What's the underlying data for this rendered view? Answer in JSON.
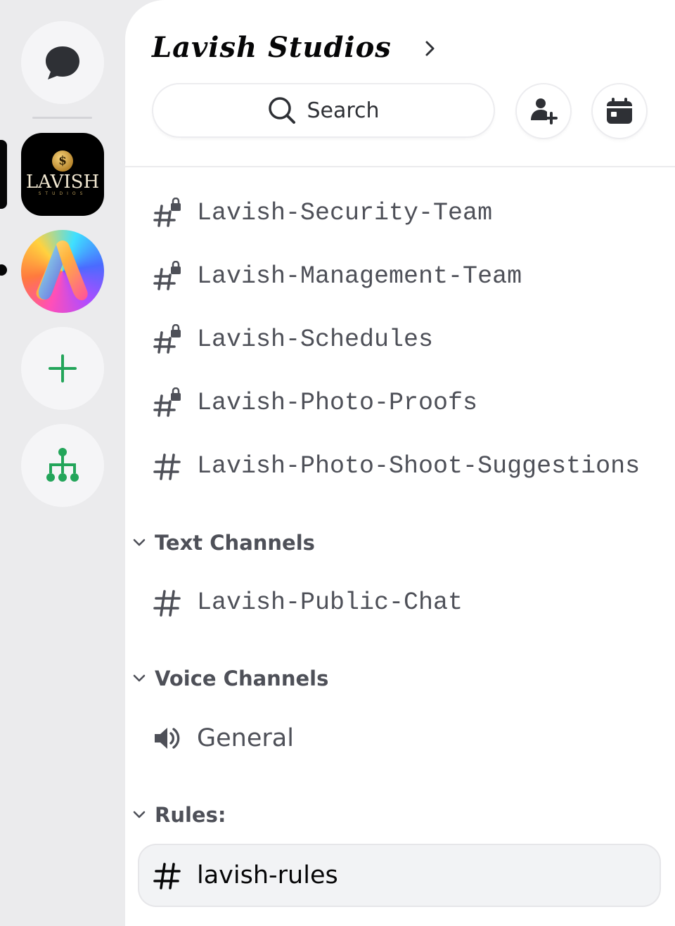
{
  "server_rail": {
    "direct_messages": {
      "icon": "chat-bubble-icon"
    },
    "servers": [
      {
        "name": "LAVISH",
        "sub": "STUDIOS",
        "initial": "$"
      },
      {
        "icon": "gradient-a-logo-icon"
      }
    ],
    "add_server": {
      "icon": "plus-icon",
      "color": "#23a55a"
    },
    "discover": {
      "icon": "hierarchy-icon",
      "color": "#23a55a"
    }
  },
  "header": {
    "server_name": "Lavish Studios",
    "search_label": "Search",
    "invite_icon": "add-person-icon",
    "events_icon": "calendar-icon"
  },
  "channels_top": [
    {
      "name": "Lavish-Security-Team",
      "locked": true
    },
    {
      "name": "Lavish-Management-Team",
      "locked": true
    },
    {
      "name": "Lavish-Schedules",
      "locked": true
    },
    {
      "name": "Lavish-Photo-Proofs",
      "locked": true
    },
    {
      "name": "Lavish-Photo-Shoot-Suggestions",
      "locked": false
    }
  ],
  "categories": {
    "text": {
      "label": "Text Channels",
      "channels": [
        {
          "name": "Lavish-Public-Chat"
        }
      ]
    },
    "voice": {
      "label": "Voice Channels",
      "channels": [
        {
          "name": "General"
        }
      ]
    },
    "rules": {
      "label": "Rules:",
      "channels": [
        {
          "name": "lavish-rules",
          "active": true
        }
      ]
    }
  },
  "colors": {
    "green": "#23a55a",
    "muted_text": "#4e5058",
    "active_text": "#060607"
  }
}
